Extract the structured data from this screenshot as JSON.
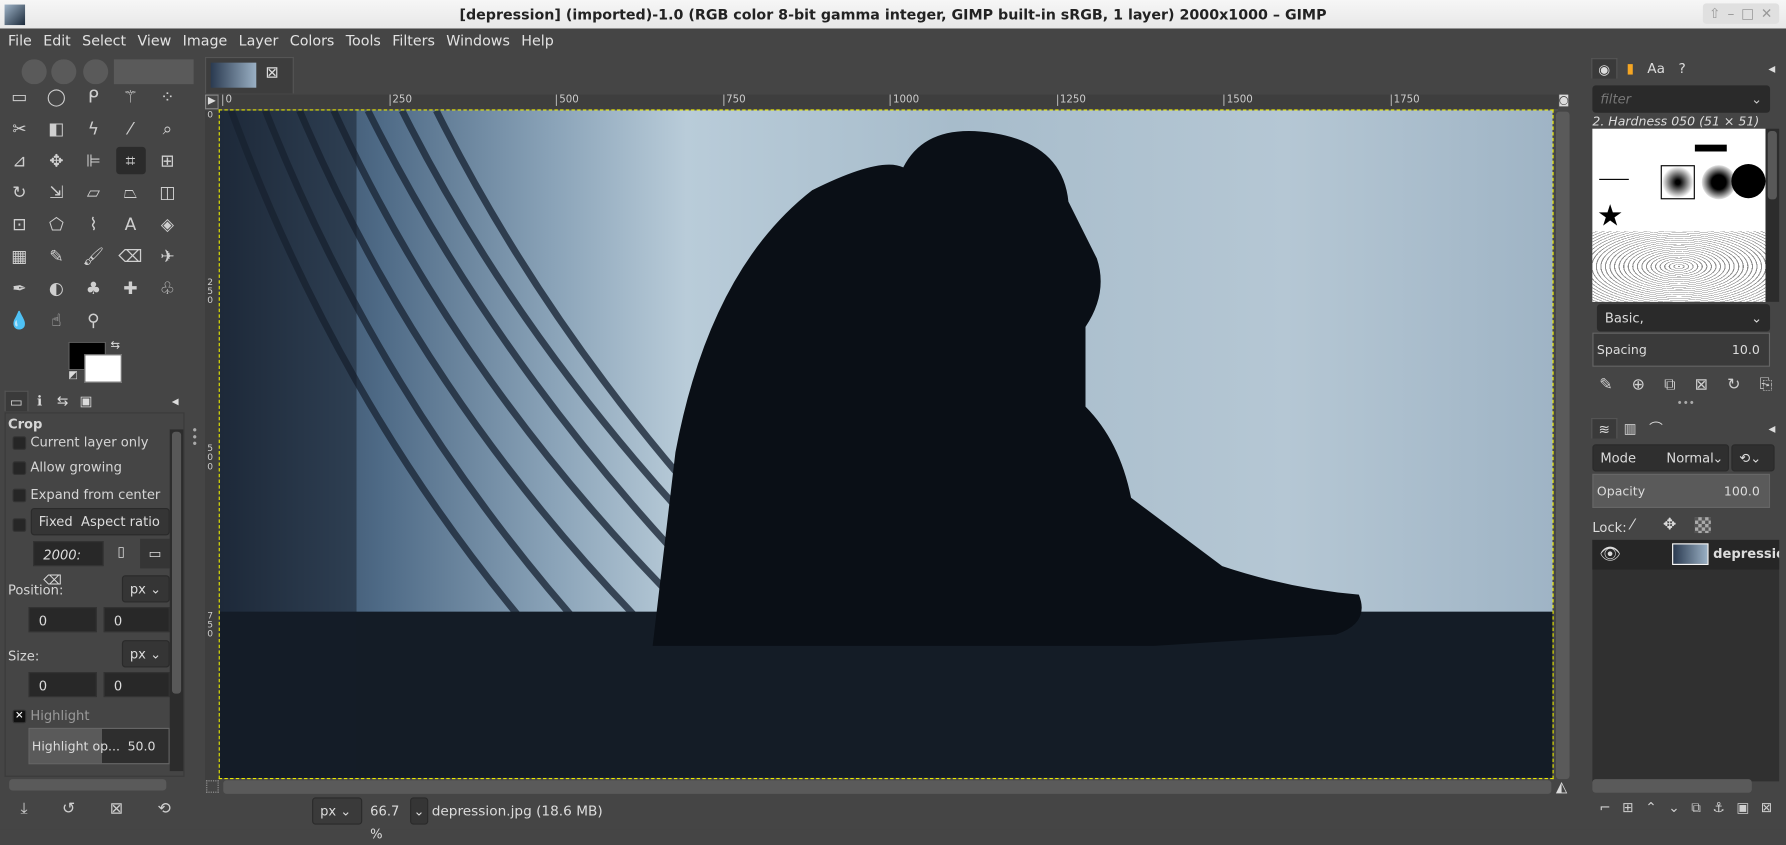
{
  "window": {
    "title": "[depression] (imported)-1.0 (RGB color 8-bit gamma integer, GIMP built-in sRGB, 1 layer) 2000x1000 – GIMP",
    "controls": [
      "⇧",
      "–",
      "□",
      "✕"
    ]
  },
  "menu": [
    "File",
    "Edit",
    "Select",
    "View",
    "Image",
    "Layer",
    "Colors",
    "Tools",
    "Filters",
    "Windows",
    "Help"
  ],
  "toolbox": {
    "tools": [
      [
        "rect-select",
        "▭"
      ],
      [
        "ellipse-select",
        "◯"
      ],
      [
        "free-select",
        "ᑭ"
      ],
      [
        "fuzzy-select",
        "⚚"
      ],
      [
        "select-by-color",
        "⁘"
      ],
      [
        "scissors-select",
        "✂"
      ],
      [
        "foreground-select",
        "◧"
      ],
      [
        "paths",
        "ϟ"
      ],
      [
        "color-picker",
        "⁄"
      ],
      [
        "zoom",
        "⌕"
      ],
      [
        "measure",
        "⊿"
      ],
      [
        "move",
        "✥"
      ],
      [
        "align",
        "⊫"
      ],
      [
        "crop",
        "⌗"
      ],
      [
        "unified-transform",
        "⊞"
      ],
      [
        "rotate",
        "↻"
      ],
      [
        "scale",
        "⇲"
      ],
      [
        "shear",
        "▱"
      ],
      [
        "perspective",
        "⏢"
      ],
      [
        "transform-3d",
        "◫"
      ],
      [
        "handle-transform",
        "⊡"
      ],
      [
        "cage-transform",
        "⬠"
      ],
      [
        "warp-transform",
        "⌇"
      ],
      [
        "text",
        "A"
      ],
      [
        "bucket-fill",
        "◈"
      ],
      [
        "gradient",
        "▦"
      ],
      [
        "pencil",
        "✎"
      ],
      [
        "paintbrush",
        "🖌"
      ],
      [
        "eraser",
        "⌫"
      ],
      [
        "airbrush",
        "✈"
      ],
      [
        "ink",
        "✒"
      ],
      [
        "mypaint-brush",
        "◐"
      ],
      [
        "clone",
        "♣"
      ],
      [
        "heal",
        "✚"
      ],
      [
        "perspective-clone",
        "♧"
      ],
      [
        "blur",
        "💧"
      ],
      [
        "smudge",
        "☝"
      ],
      [
        "dodge-burn",
        "⚲"
      ]
    ],
    "active_tool": "crop"
  },
  "tool_options": {
    "title": "Crop",
    "current_layer_only": "Current layer only",
    "allow_growing": "Allow growing",
    "expand_from_center": "Expand from center",
    "fixed": "Fixed",
    "fixed_mode": "Aspect ratio",
    "ratio_value": "2000:",
    "position_label": "Position:",
    "position_unit": "px",
    "pos_x": "0",
    "pos_y": "0",
    "size_label": "Size:",
    "size_unit": "px",
    "size_w": "0",
    "size_h": "0",
    "highlight": "Highlight",
    "highlight_opacity_label": "Highlight op...",
    "highlight_opacity": "50.0"
  },
  "image_tab": {
    "close": "⊠"
  },
  "rulers": {
    "top": [
      "0",
      "250",
      "500",
      "750",
      "1000",
      "1250",
      "1500",
      "1750"
    ],
    "left": [
      "0",
      "250",
      "500",
      "750"
    ]
  },
  "status": {
    "unit": "px",
    "zoom": "66.7 %",
    "file": "depression.jpg (18.6 MB)"
  },
  "brushes": {
    "filter_placeholder": "filter",
    "selected": "2. Hardness 050 (51 × 51)",
    "tag": "Basic,",
    "spacing_label": "Spacing",
    "spacing": "10.0"
  },
  "layers": {
    "mode_label": "Mode",
    "mode": "Normal",
    "opacity_label": "Opacity",
    "opacity": "100.0",
    "lock_label": "Lock:",
    "items": [
      {
        "name": "depression",
        "visible": true
      }
    ]
  },
  "colors": {
    "foreground": "#000000",
    "background": "#ffffff",
    "selection": "#e8e800"
  }
}
